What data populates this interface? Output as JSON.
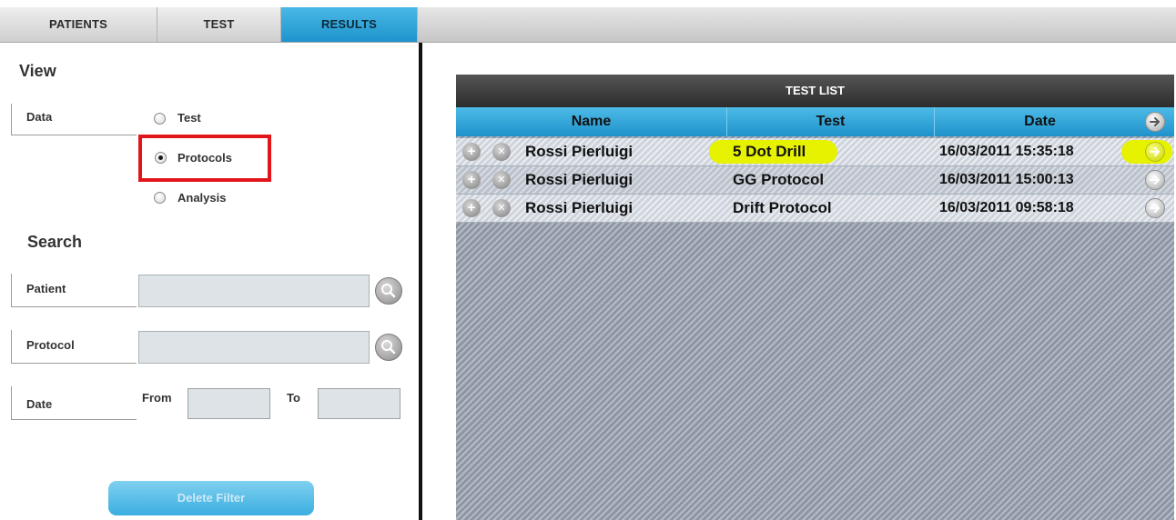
{
  "tabs": [
    {
      "label": "PATIENTS",
      "active": false
    },
    {
      "label": "TEST",
      "active": false
    },
    {
      "label": "RESULTS",
      "active": true
    }
  ],
  "view": {
    "title": "View",
    "data_label": "Data",
    "options": [
      {
        "label": "Test",
        "checked": false
      },
      {
        "label": "Protocols",
        "checked": true
      },
      {
        "label": "Analysis",
        "checked": false
      }
    ]
  },
  "search": {
    "title": "Search",
    "patient_label": "Patient",
    "patient_value": "",
    "protocol_label": "Protocol",
    "protocol_value": "",
    "date_label": "Date",
    "from_label": "From",
    "from_value": "",
    "to_label": "To",
    "to_value": ""
  },
  "delete_filter_label": "Delete Filter",
  "test_list": {
    "title": "TEST LIST",
    "columns": [
      "Name",
      "Test",
      "Date"
    ],
    "rows": [
      {
        "name": "Rossi Pierluigi",
        "test": "5 Dot Drill",
        "date": "16/03/2011 15:35:18",
        "highlighted": true
      },
      {
        "name": "Rossi Pierluigi",
        "test": "GG Protocol",
        "date": "16/03/2011 15:00:13",
        "highlighted": false
      },
      {
        "name": "Rossi Pierluigi",
        "test": "Drift Protocol",
        "date": "16/03/2011 09:58:18",
        "highlighted": false
      }
    ]
  },
  "colors": {
    "accent": "#1e93cc",
    "highlight": "#e6f200",
    "annotation_red": "#e2161a"
  },
  "icons": {
    "search": "magnifier-icon",
    "add": "plus-circle-icon",
    "remove": "x-circle-icon",
    "open": "arrow-right-circle-icon"
  }
}
